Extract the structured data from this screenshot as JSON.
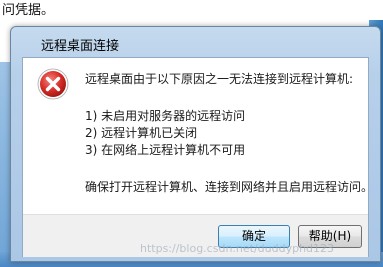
{
  "background": {
    "text": "问凭据。"
  },
  "dialog": {
    "title": "远程桌面连接",
    "message": "远程桌面由于以下原因之一无法连接到远程计算机:",
    "reasons": [
      "1) 未启用对服务器的远程访问",
      "2) 远程计算机已关闭",
      "3) 在网络上远程计算机不可用"
    ],
    "advice": "确保打开远程计算机、连接到网络并且启用远程访问。",
    "buttons": {
      "ok": "确定",
      "help": "帮助(H)"
    },
    "icon": "error-icon"
  },
  "watermark": "https://blog.csdn.net/duddyphd123",
  "colors": {
    "error_red": "#d9302b",
    "title_bar": "#b7d0ea",
    "ok_border": "#3c7fb1"
  }
}
